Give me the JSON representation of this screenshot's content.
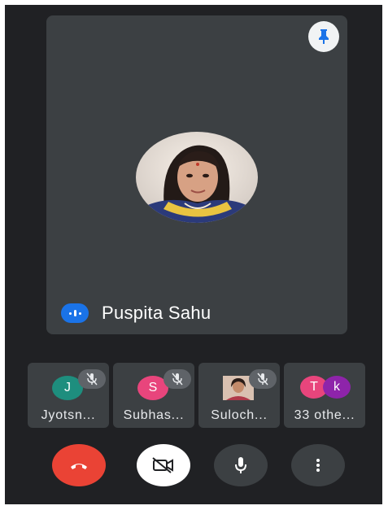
{
  "main_speaker": {
    "name": "Puspita Sahu",
    "pin_icon": "pin-icon",
    "speaking_icon": "speaking-indicator-icon"
  },
  "participants": [
    {
      "initial": "J",
      "label": "Jyotsn...",
      "avatar_color": "#1e8e7e",
      "muted": true
    },
    {
      "initial": "S",
      "label": "Subhas...",
      "avatar_color": "#e8457c",
      "muted": true
    },
    {
      "initial": "",
      "label": "Suloch...",
      "avatar_color": "#8a5a44",
      "muted": true,
      "photo": true
    },
    {
      "initials": [
        "T",
        "k"
      ],
      "label": "33 othe...",
      "avatar_colors": [
        "#e8457c",
        "#8e24aa"
      ],
      "muted": false
    }
  ],
  "controls": {
    "end_call_icon": "end-call-icon",
    "camera_icon": "camera-off-icon",
    "mic_icon": "mic-icon",
    "more_icon": "more-options-icon",
    "colors": {
      "end_call": "#ea4335",
      "camera": "#ffffff",
      "neutral": "#3c4043"
    }
  }
}
